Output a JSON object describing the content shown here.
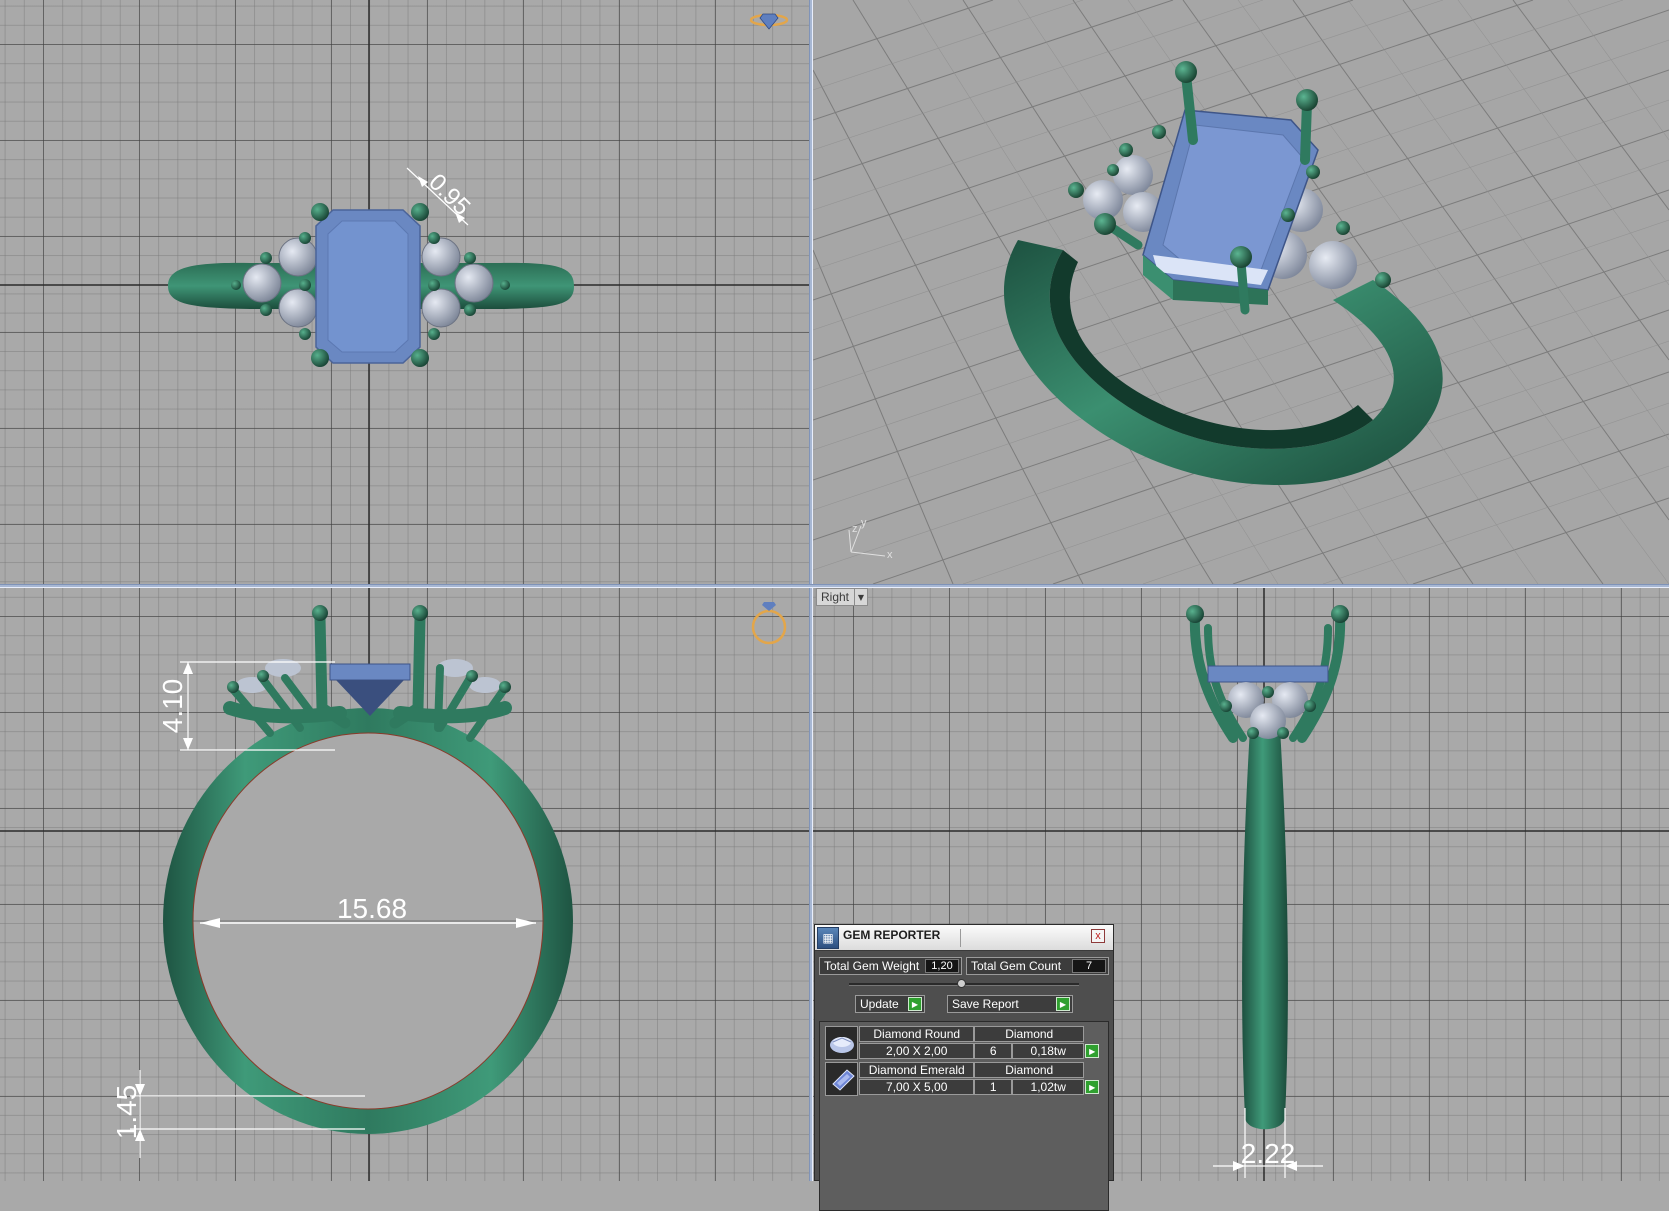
{
  "viewports": {
    "top": {
      "dim_prong": "0.95"
    },
    "perspective": {
      "axis_x": "x",
      "axis_y": "y",
      "axis_z": "z"
    },
    "front": {
      "dim_height": "4.10",
      "dim_inner": "15.68",
      "dim_shank": "1.45"
    },
    "right": {
      "view_label": "Right",
      "dim_width": "2.22"
    }
  },
  "gem_reporter": {
    "title": "GEM REPORTER",
    "close_glyph": "x",
    "total_weight_label": "Total Gem Weight",
    "total_weight_value": "1,20",
    "total_count_label": "Total Gem Count",
    "total_count_value": "7",
    "update_label": "Update",
    "save_label": "Save Report",
    "gems": [
      {
        "name": "Diamond Round",
        "material": "Diamond",
        "size": "2,00 X 2,00",
        "count": "6",
        "weight": "0,18tw",
        "icon": "round-gem-icon"
      },
      {
        "name": "Diamond Emerald",
        "material": "Diamond",
        "size": "7,00 X 5,00",
        "count": "1",
        "weight": "1,02tw",
        "icon": "emerald-gem-icon"
      }
    ]
  },
  "colors": {
    "metal": "#2f7a5f",
    "metal_dark": "#1b4c3b",
    "center_stone": "#6f8cc8",
    "side_stone": "#b9c1cf",
    "grid_bg": "#a9a9a9",
    "dim_color": "#ffffff",
    "panel_bg": "#4e4e4e",
    "accent_green": "#2fa02f"
  }
}
